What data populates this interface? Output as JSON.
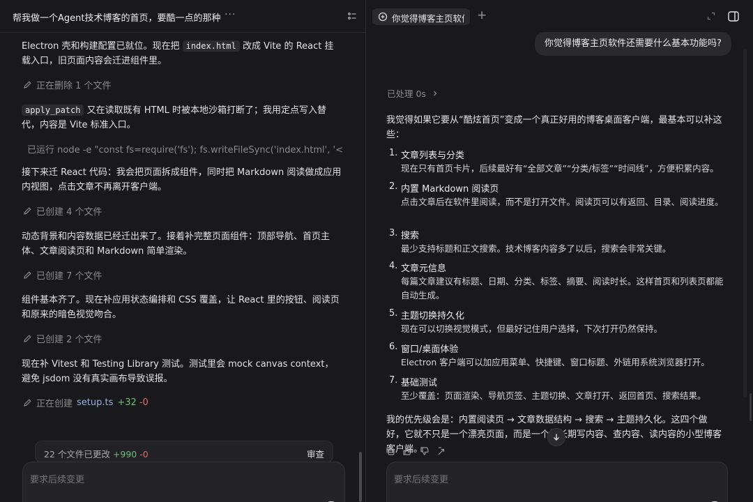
{
  "left": {
    "title": "帮我做一个Agent技术博客的首页，要酷一点的那种",
    "more": "···",
    "p1": {
      "a": "Electron 壳和构建配置已就位。现在把 ",
      "code": "index.html",
      "b": " 改成 Vite 的 React 挂载入口，旧页面内容会迁进组件里。"
    },
    "act1": "正在删除 1 个文件",
    "p2": {
      "code": "apply_patch",
      "b": " 又在读取既有 HTML 时被本地沙箱打断了；我用定点写入替代，内容是 Vite 标准入口。"
    },
    "act2": "已运行 node -e \"const fs=require('fs'); fs.writeFileSync('index.html', '<...",
    "p3": "接下来迁 React 代码：我会把页面拆成组件，同时把 Markdown 阅读做成应用内视图，点击文章不再离开客户端。",
    "act3": "已创建 4 个文件",
    "p4": "动态背景和内容数据已经迁出来了。接着补完整页面组件：顶部导航、首页主体、文章阅读页和 Markdown 简单渲染。",
    "act4": "已创建 7 个文件",
    "p5": "组件基本齐了。现在补应用状态编排和 CSS 覆盖，让 React 里的按钮、阅读页和原来的暗色视觉吻合。",
    "act5": "已创建 2 个文件",
    "p6": "现在补 Vitest 和 Testing Library 测试。测试里会 mock canvas context，避免 jsdom 没有真实画布导致误报。",
    "act6": {
      "label": "正在创建",
      "file": "setup.ts",
      "plus": "+32",
      "minus": "-0"
    },
    "changes": {
      "label": "22 个文件已更改",
      "plus": "+990",
      "minus": "-0",
      "review": "审查"
    },
    "composer_placeholder": "要求后续变更"
  },
  "right": {
    "tab_label": "你觉得博客主页软件",
    "new_tab": "+",
    "user_message": "你觉得博客主页软件还需要什么基本功能吗?",
    "processed": "已处理 0s",
    "intro": "我觉得如果它要从“酷炫首页”变成一个真正好用的博客桌面客户端，最基本可以补这些：",
    "items": [
      {
        "num": "1.",
        "title": "文章列表与分类",
        "desc": "现在只有首页卡片，后续最好有“全部文章”“分类/标签”“时间线”，方便积累内容。"
      },
      {
        "num": "2.",
        "title": "内置 Markdown 阅读页",
        "desc": "点击文章后在软件里阅读，而不是打开文件。阅读页可以有返回、目录、阅读进度。"
      },
      {
        "num": "3.",
        "title": "搜索",
        "desc": "最少支持标题和正文搜索。技术博客内容多了以后，搜索会非常关键。"
      },
      {
        "num": "4.",
        "title": "文章元信息",
        "desc": "每篇文章建议有标题、日期、分类、标签、摘要、阅读时长。这样首页和列表页都能自动生成。"
      },
      {
        "num": "5.",
        "title": "主题切换持久化",
        "desc": "现在可以切换视觉模式，但最好记住用户选择，下次打开仍然保持。"
      },
      {
        "num": "6.",
        "title": "窗口/桌面体验",
        "desc": "Electron 客户端可以加应用菜单、快捷键、窗口标题、外链用系统浏览器打开。"
      },
      {
        "num": "7.",
        "title": "基础测试",
        "desc": "至少覆盖：页面渲染、导航页签、主题切换、文章打开、返回首页、搜索结果。"
      }
    ],
    "conclusion": "我的优先级会是：内置阅读页 → 文章数据结构 → 搜索 → 主题持久化。这四个做好，它就不只是一个漂亮页面，而是一个能长期写内容、查内容、读内容的小型博客客户端。",
    "composer_placeholder": "要求后续变更"
  },
  "icons": [
    "list-icon",
    "new-chat-icon",
    "expand-icon",
    "panel-icon",
    "pencil-icon",
    "terminal-icon",
    "copy-icon",
    "thumbs-up-icon",
    "thumbs-down-icon",
    "share-icon",
    "chevron-right-icon",
    "arrow-down-icon"
  ]
}
